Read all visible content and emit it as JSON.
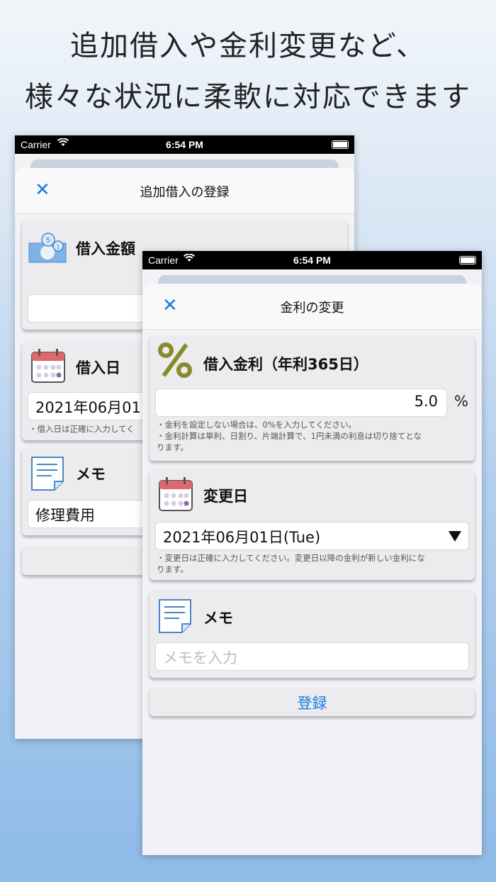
{
  "headline": {
    "line1": "追加借入や金利変更など、",
    "line2": "様々な状況に柔軟に対応できます"
  },
  "status_bar": {
    "carrier": "Carrier",
    "time": "6:54 PM"
  },
  "back_screen": {
    "nav_title": "追加借入の登録",
    "amount_section_title": "借入金額",
    "date_section_title": "借入日",
    "date_value": "2021年06月01",
    "date_note": "・借入日は正確に入力してく",
    "memo_section_title": "メモ",
    "memo_value": "修理費用"
  },
  "front_screen": {
    "nav_title": "金利の変更",
    "rate_section_title": "借入金利（年利365日）",
    "rate_value": "5.0",
    "rate_unit": "%",
    "rate_note_1": "・金利を設定しない場合は、0%を入力してください。",
    "rate_note_2": "・金利計算は単利、日割り、片端計算で、1円未満の利息は切り捨てとな",
    "rate_note_3": "ります。",
    "date_section_title": "変更日",
    "date_value": "2021年06月01日(Tue)",
    "date_note_1": "・変更日は正確に入力してください。変更日以降の金利が新しい金利にな",
    "date_note_2": "ります。",
    "memo_section_title": "メモ",
    "memo_placeholder": "メモを入力",
    "register_label": "登録"
  },
  "icons": {
    "close": "close-icon",
    "money": "money-icon",
    "calendar": "calendar-icon",
    "memo": "memo-icon",
    "percent": "percent-icon",
    "dropdown": "chevron-down-icon"
  },
  "colors": {
    "accent": "#1a7ae0",
    "percent_icon": "#8a8a2a",
    "calendar_red": "#e06670"
  }
}
